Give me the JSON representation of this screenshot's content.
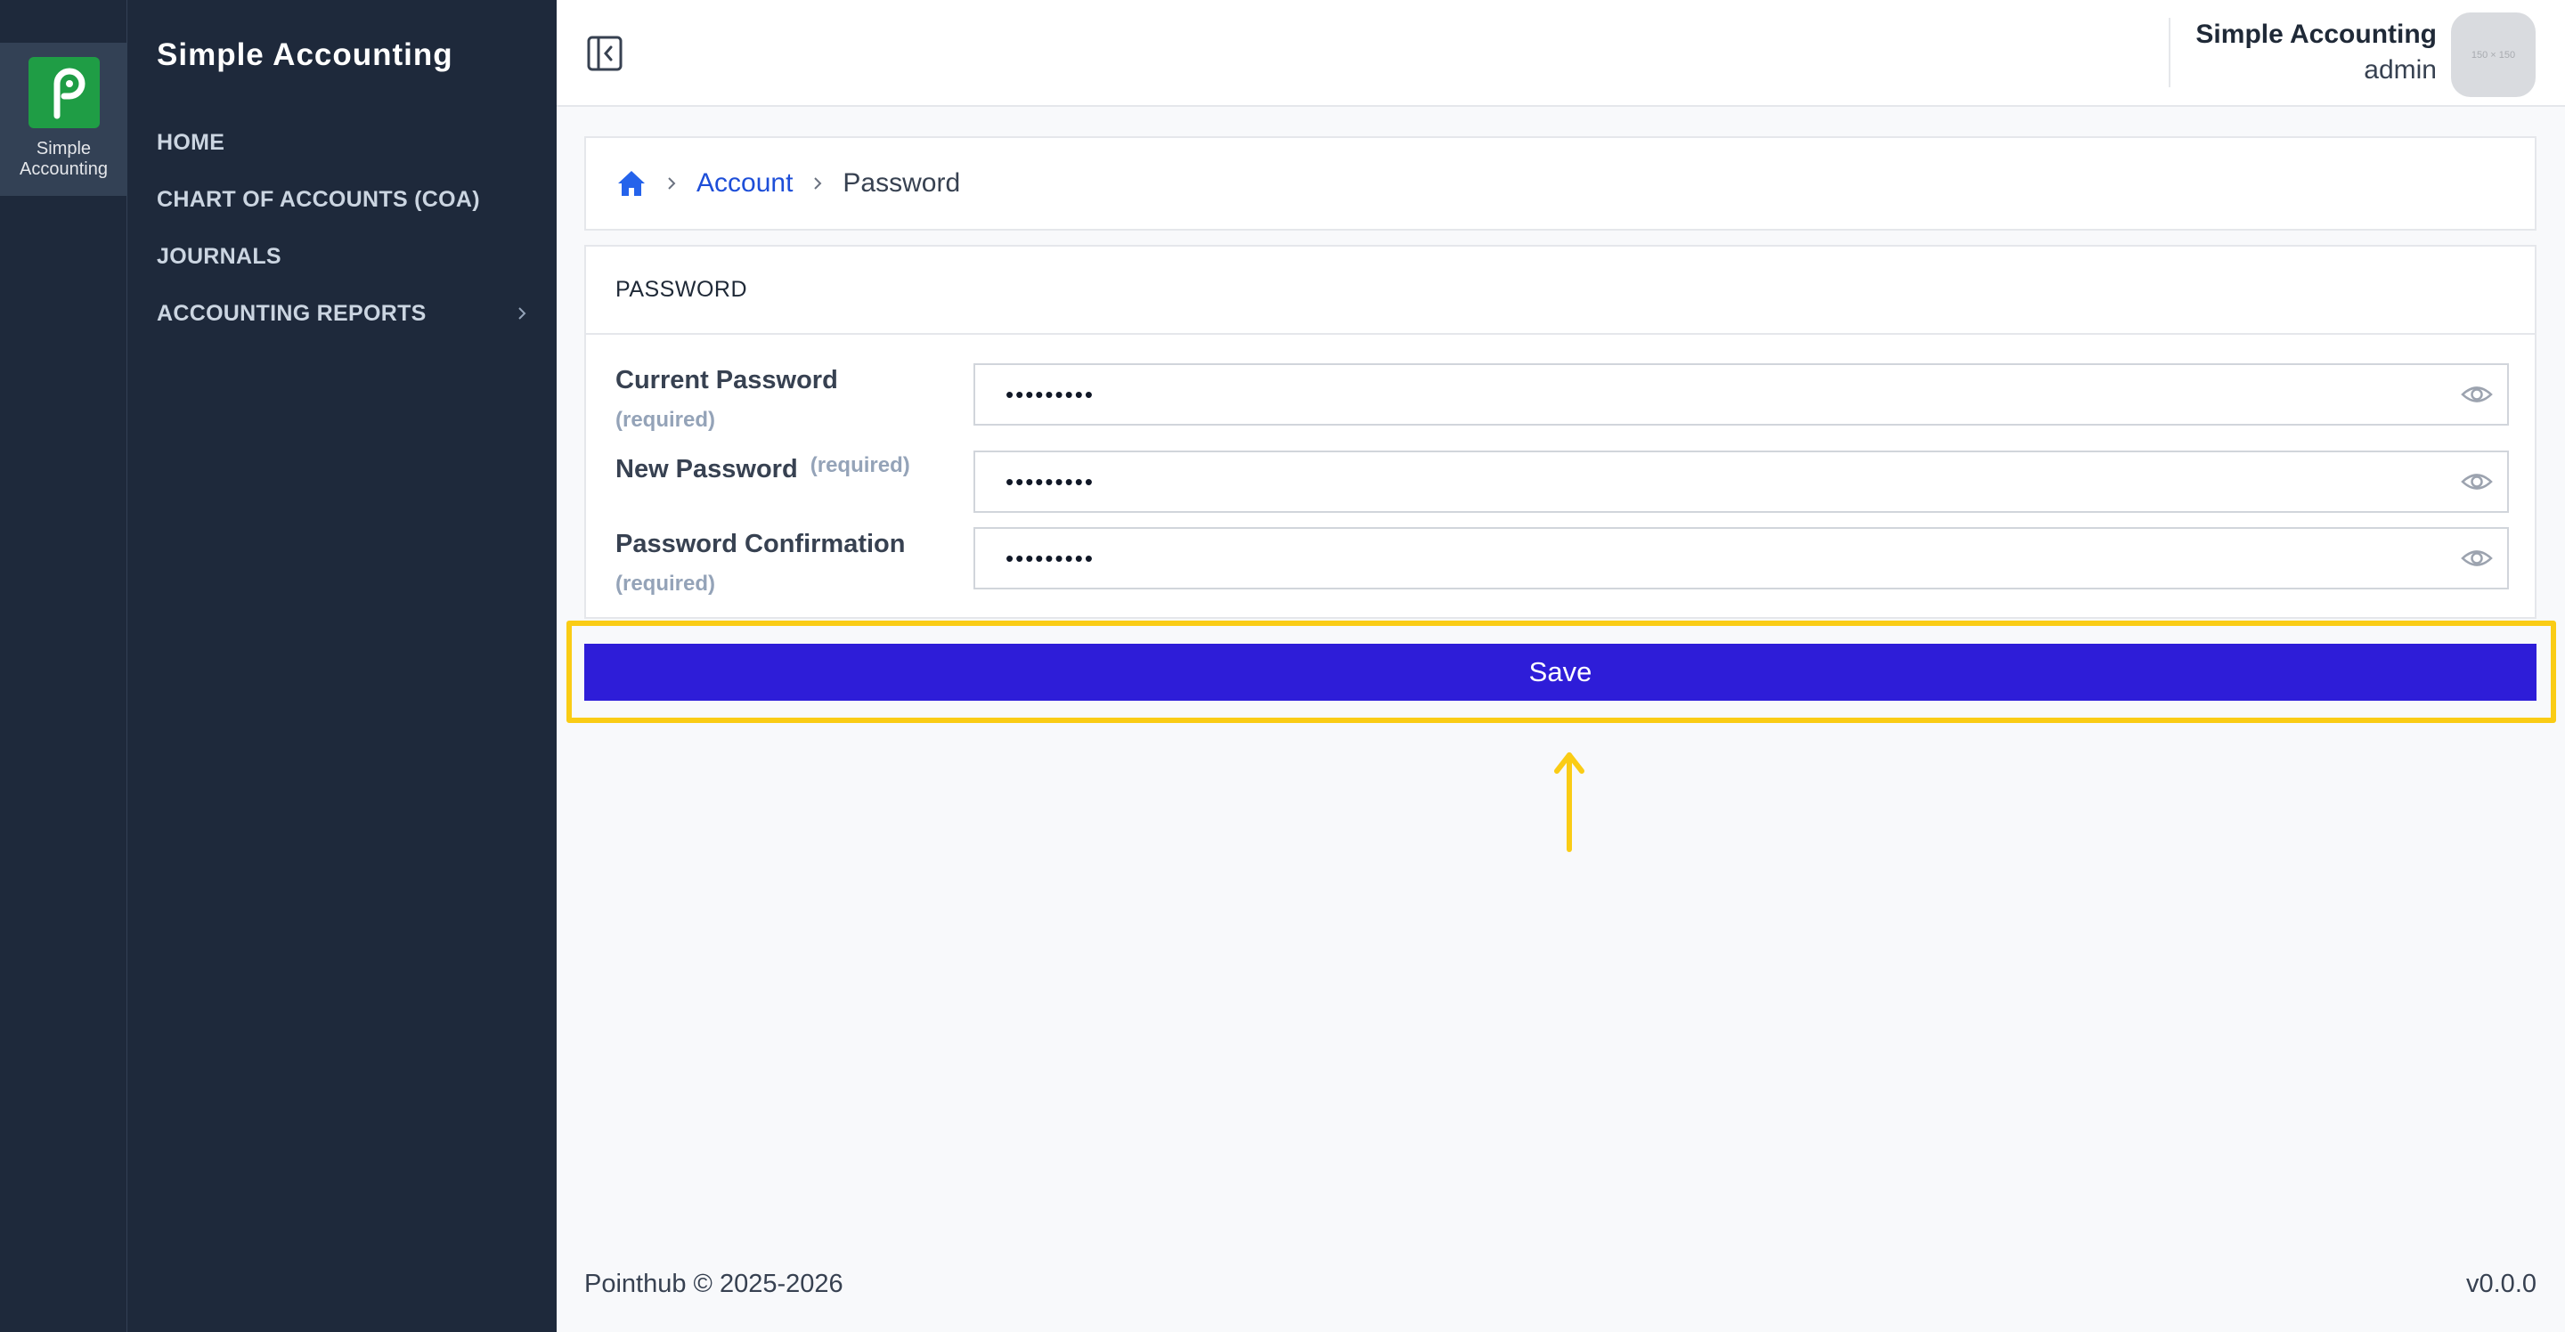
{
  "rail": {
    "app_label": "Simple Accounting"
  },
  "sidebar": {
    "title": "Simple Accounting",
    "items": [
      {
        "label": "HOME"
      },
      {
        "label": "CHART OF ACCOUNTS (COA)"
      },
      {
        "label": "JOURNALS"
      },
      {
        "label": "ACCOUNTING REPORTS"
      }
    ]
  },
  "header": {
    "user_name": "Simple Accounting",
    "user_role": "admin",
    "avatar_text": "150 × 150"
  },
  "breadcrumb": {
    "items": [
      {
        "label": "Account"
      },
      {
        "label": "Password"
      }
    ]
  },
  "form": {
    "title": "PASSWORD",
    "fields": [
      {
        "label": "Current Password",
        "required": "(required)",
        "value": "•••••••••"
      },
      {
        "label": "New Password",
        "required": "(required)",
        "value": "•••••••••"
      },
      {
        "label": "Password Confirmation",
        "required": "(required)",
        "value": "•••••••••"
      }
    ],
    "save_label": "Save"
  },
  "footer": {
    "copyright": "Pointhub © 2025-2026",
    "version": "v0.0.0"
  },
  "colors": {
    "sidebar_bg": "#1e293b",
    "accent_button": "#2e1dd8",
    "highlight": "#facc15",
    "logo_green": "#1f9d45",
    "link": "#1d4ed8"
  },
  "icons": [
    "app-logo-icon",
    "collapse-sidebar-icon",
    "home-icon",
    "chevron-right-icon",
    "eye-icon",
    "arrow-up-icon"
  ]
}
